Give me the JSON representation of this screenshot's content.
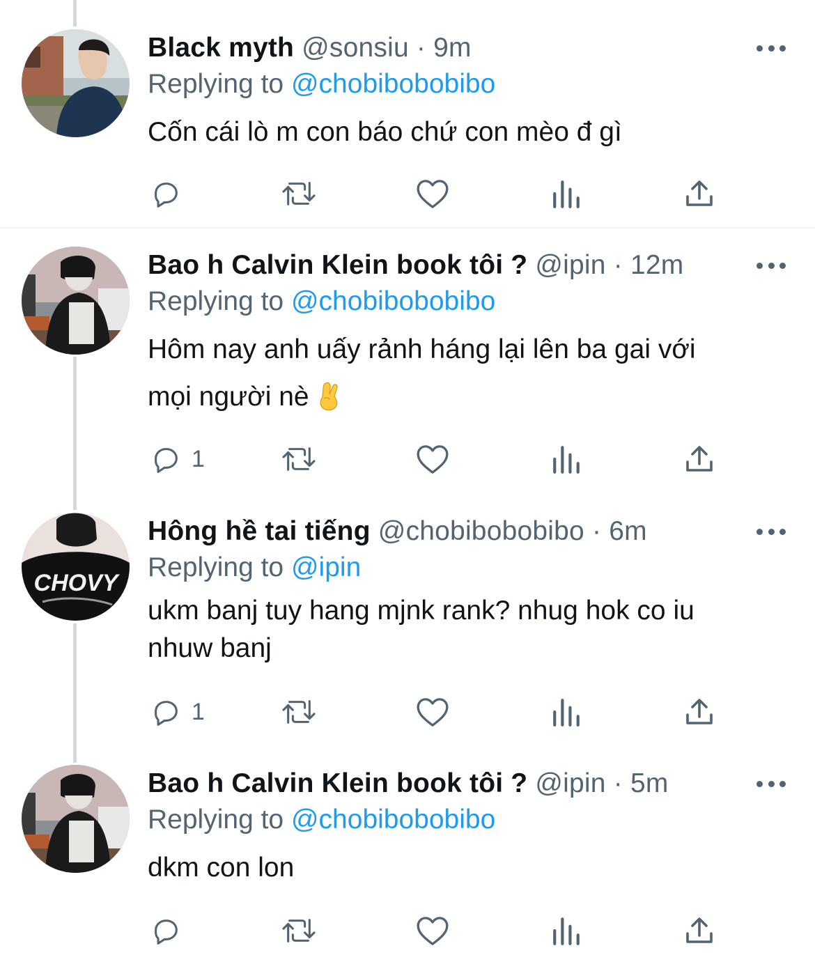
{
  "colors": {
    "text": "#0f1419",
    "secondary": "#536471",
    "accent": "#1d9bf0",
    "thread_line": "#cfd9de"
  },
  "tweets": [
    {
      "name": "Black myth",
      "handle": "@sonsiu",
      "separator": "·",
      "time": "9m",
      "replying_prefix": "Replying to",
      "replying_to": "@chobibobobibo",
      "text": "Cốn cái lò m con báo chứ con mèo đ gì",
      "text_cont": "",
      "reply_count": "",
      "avatar": "avatar-black-myth"
    },
    {
      "name": "Bao h Calvin Klein book tôi ?",
      "handle": "@ipin",
      "separator": "·",
      "time": "12m",
      "replying_prefix": "Replying to",
      "replying_to": "@chobibobobibo",
      "text": "Hôm nay anh uấy rảnh háng lại lên ba gai với",
      "text_cont": "mọi người nè",
      "emoji": "crossed-fingers-emoji",
      "reply_count": "1",
      "avatar": "avatar-ipin"
    },
    {
      "name": "Hông hề tai tiếng",
      "handle": "@chobibobobibo",
      "separator": "·",
      "time": "6m",
      "replying_prefix": "Replying to",
      "replying_to": "@ipin",
      "text": "ukm banj tuy hang mjnk rank? nhug hok co iu",
      "text_cont": "nhuw banj",
      "reply_count": "1",
      "avatar": "avatar-chovy"
    },
    {
      "name": "Bao h Calvin Klein book tôi ?",
      "handle": "@ipin",
      "separator": "·",
      "time": "5m",
      "replying_prefix": "Replying to",
      "replying_to": "@chobibobobibo",
      "text": "dkm con lon",
      "text_cont": "",
      "reply_count": "",
      "avatar": "avatar-ipin"
    }
  ],
  "icons": [
    "reply-icon",
    "retweet-icon",
    "like-icon",
    "analytics-icon",
    "share-icon",
    "more-icon"
  ],
  "avatar_text": "CHOVY"
}
